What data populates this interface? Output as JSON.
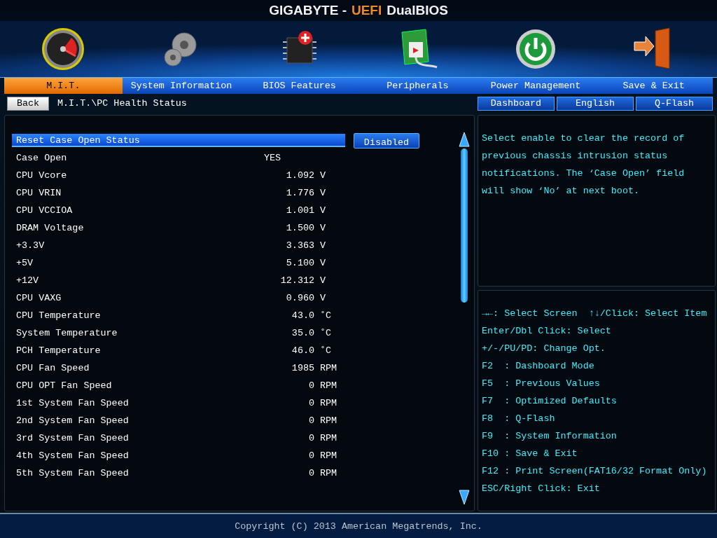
{
  "title": [
    {
      "text": "GIGABYTE -",
      "kind": "plain"
    },
    {
      "text": "UEFI",
      "kind": "accent"
    },
    {
      "text": "DualBIOS",
      "kind": "plain"
    }
  ],
  "tabs": [
    {
      "label": "M.I.T.",
      "kind": "gauge",
      "selected": true
    },
    {
      "label": "System Information",
      "kind": "gear",
      "selected": false
    },
    {
      "label": "BIOS Features",
      "kind": "chip",
      "selected": false
    },
    {
      "label": "Peripherals",
      "kind": "card",
      "selected": false
    },
    {
      "label": "Power Management",
      "kind": "power",
      "selected": false
    },
    {
      "label": "Save & Exit",
      "kind": "door",
      "selected": false
    }
  ],
  "back_button": "Back",
  "breadcrumb": "M.I.T.\\PC Health Status",
  "top_buttons": [
    "Dashboard",
    "English",
    "Q-Flash"
  ],
  "rows": [
    {
      "kind": "option",
      "label": "Reset Case Open Status",
      "value": "Disabled",
      "selected": true
    },
    {
      "kind": "status",
      "label": "Case Open",
      "value": "YES"
    },
    {
      "kind": "reading",
      "label": "CPU Vcore",
      "value": "1.092",
      "unit": "V"
    },
    {
      "kind": "reading",
      "label": "CPU VRIN",
      "value": "1.776",
      "unit": "V"
    },
    {
      "kind": "reading",
      "label": "CPU VCCIOA",
      "value": "1.001",
      "unit": "V"
    },
    {
      "kind": "reading",
      "label": "DRAM Voltage",
      "value": "1.500",
      "unit": "V"
    },
    {
      "kind": "reading",
      "label": "+3.3V",
      "value": "3.363",
      "unit": "V"
    },
    {
      "kind": "reading",
      "label": "+5V",
      "value": "5.100",
      "unit": "V"
    },
    {
      "kind": "reading",
      "label": "+12V",
      "value": "12.312",
      "unit": "V"
    },
    {
      "kind": "reading",
      "label": "CPU VAXG",
      "value": "0.960",
      "unit": "V"
    },
    {
      "kind": "reading",
      "label": "CPU Temperature",
      "value": "43.0",
      "unit": "˚C"
    },
    {
      "kind": "reading",
      "label": "System Temperature",
      "value": "35.0",
      "unit": "˚C"
    },
    {
      "kind": "reading",
      "label": "PCH Temperature",
      "value": "46.0",
      "unit": "˚C"
    },
    {
      "kind": "reading",
      "label": "CPU Fan Speed",
      "value": "1985",
      "unit": "RPM"
    },
    {
      "kind": "reading",
      "label": "CPU OPT Fan Speed",
      "value": "0",
      "unit": "RPM"
    },
    {
      "kind": "reading",
      "label": "1st System Fan Speed",
      "value": "0",
      "unit": "RPM"
    },
    {
      "kind": "reading",
      "label": "2nd System Fan Speed",
      "value": "0",
      "unit": "RPM"
    },
    {
      "kind": "reading",
      "label": "3rd System Fan Speed",
      "value": "0",
      "unit": "RPM"
    },
    {
      "kind": "reading",
      "label": "4th System Fan Speed",
      "value": "0",
      "unit": "RPM"
    },
    {
      "kind": "reading",
      "label": "5th System Fan Speed",
      "value": "0",
      "unit": "RPM"
    }
  ],
  "help_lines": [
    "Select enable to clear the record of",
    "previous chassis intrusion status",
    "notifications. The ‘Case Open’ field",
    "will show ‘No’ at next boot."
  ],
  "key_lines": [
    "→←: Select Screen  ↑↓/Click: Select Item",
    "Enter/Dbl Click: Select",
    "+/-/PU/PD: Change Opt.",
    "F2  : Dashboard Mode",
    "F5  : Previous Values",
    "F7  : Optimized Defaults",
    "F8  : Q-Flash",
    "F9  : System Information",
    "F10 : Save & Exit",
    "F12 : Print Screen(FAT16/32 Format Only)",
    "ESC/Right Click: Exit"
  ],
  "footer": "Copyright (C) 2013 American Megatrends, Inc."
}
